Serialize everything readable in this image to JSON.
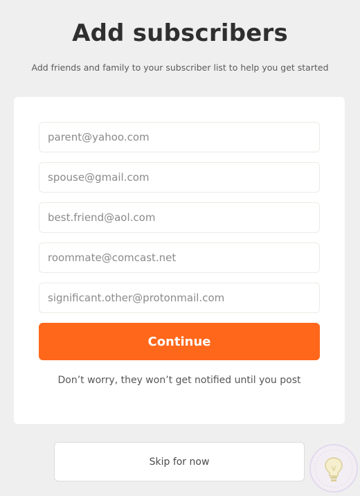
{
  "header": {
    "title": "Add subscribers",
    "subtitle": "Add friends and family to your subscriber list to help you get started"
  },
  "form": {
    "fields": [
      {
        "placeholder": "parent@yahoo.com"
      },
      {
        "placeholder": "spouse@gmail.com"
      },
      {
        "placeholder": "best.friend@aol.com"
      },
      {
        "placeholder": "roommate@comcast.net"
      },
      {
        "placeholder": "significant.other@protonmail.com"
      }
    ],
    "continue_label": "Continue",
    "note": "Don’t worry, they won’t get notified until you post"
  },
  "footer": {
    "skip_label": "Skip for now"
  },
  "badge": {
    "icon": "lightbulb-icon"
  },
  "colors": {
    "accent": "#ff671a",
    "background": "#efefef",
    "card": "#ffffff"
  }
}
